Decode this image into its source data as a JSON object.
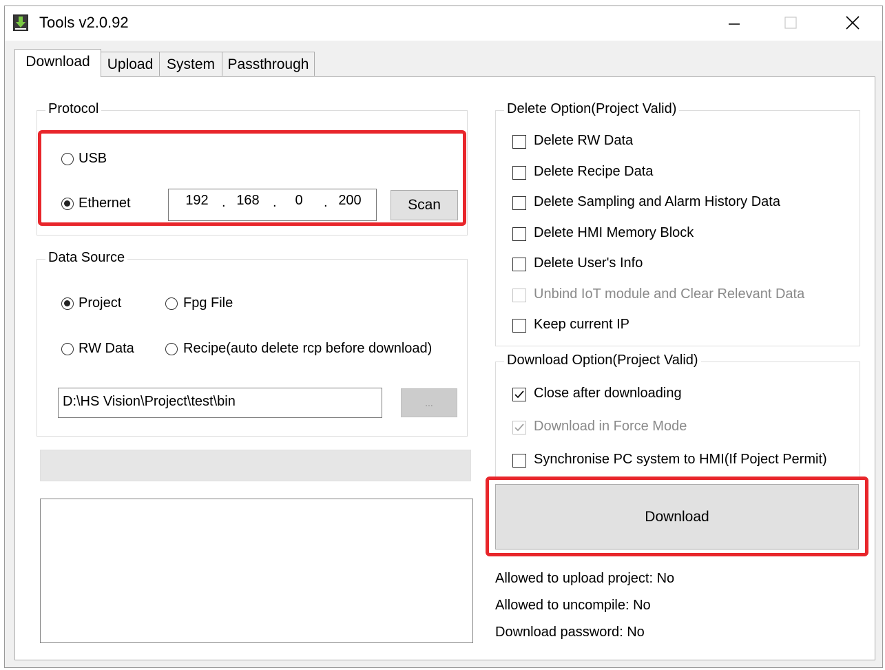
{
  "window": {
    "title": "Tools v2.0.92"
  },
  "tabs": [
    {
      "label": "Download",
      "active": true
    },
    {
      "label": "Upload",
      "active": false
    },
    {
      "label": "System",
      "active": false
    },
    {
      "label": "Passthrough",
      "active": false
    }
  ],
  "protocol": {
    "legend": "Protocol",
    "usb_label": "USB",
    "ethernet_label": "Ethernet",
    "selected": "Ethernet",
    "ip": [
      "192",
      "168",
      "0",
      "200"
    ],
    "scan_label": "Scan"
  },
  "data_source": {
    "legend": "Data Source",
    "project_label": "Project",
    "fpg_label": "Fpg File",
    "rw_label": "RW Data",
    "recipe_label": "Recipe(auto delete rcp before download)",
    "selected": "Project",
    "path_value": "D:\\HS Vision\\Project\\test\\bin",
    "browse_label": "..."
  },
  "delete_option": {
    "legend": "Delete Option(Project Valid)",
    "items": [
      {
        "label": "Delete RW Data",
        "checked": false,
        "enabled": true
      },
      {
        "label": "Delete Recipe Data",
        "checked": false,
        "enabled": true
      },
      {
        "label": "Delete Sampling and Alarm History Data",
        "checked": false,
        "enabled": true
      },
      {
        "label": "Delete HMI Memory Block",
        "checked": false,
        "enabled": true
      },
      {
        "label": "Delete User's Info",
        "checked": false,
        "enabled": true
      },
      {
        "label": "Unbind IoT module and Clear Relevant Data",
        "checked": false,
        "enabled": false
      },
      {
        "label": "Keep current IP",
        "checked": false,
        "enabled": true
      }
    ]
  },
  "download_option": {
    "legend": "Download Option(Project Valid)",
    "items": [
      {
        "label": "Close after downloading",
        "checked": true,
        "enabled": true
      },
      {
        "label": "Download in Force Mode",
        "checked": true,
        "enabled": false
      },
      {
        "label": "Synchronise PC system to HMI(If Poject Permit)",
        "checked": false,
        "enabled": true
      }
    ]
  },
  "download_button_label": "Download",
  "info": {
    "upload": "Allowed to upload project: No",
    "uncompile": "Allowed to uncompile: No",
    "password": "Download password: No"
  },
  "colors": {
    "highlight": "#e8262b",
    "window_bg": "#f0f0f0",
    "panel_bg": "#ffffff"
  }
}
